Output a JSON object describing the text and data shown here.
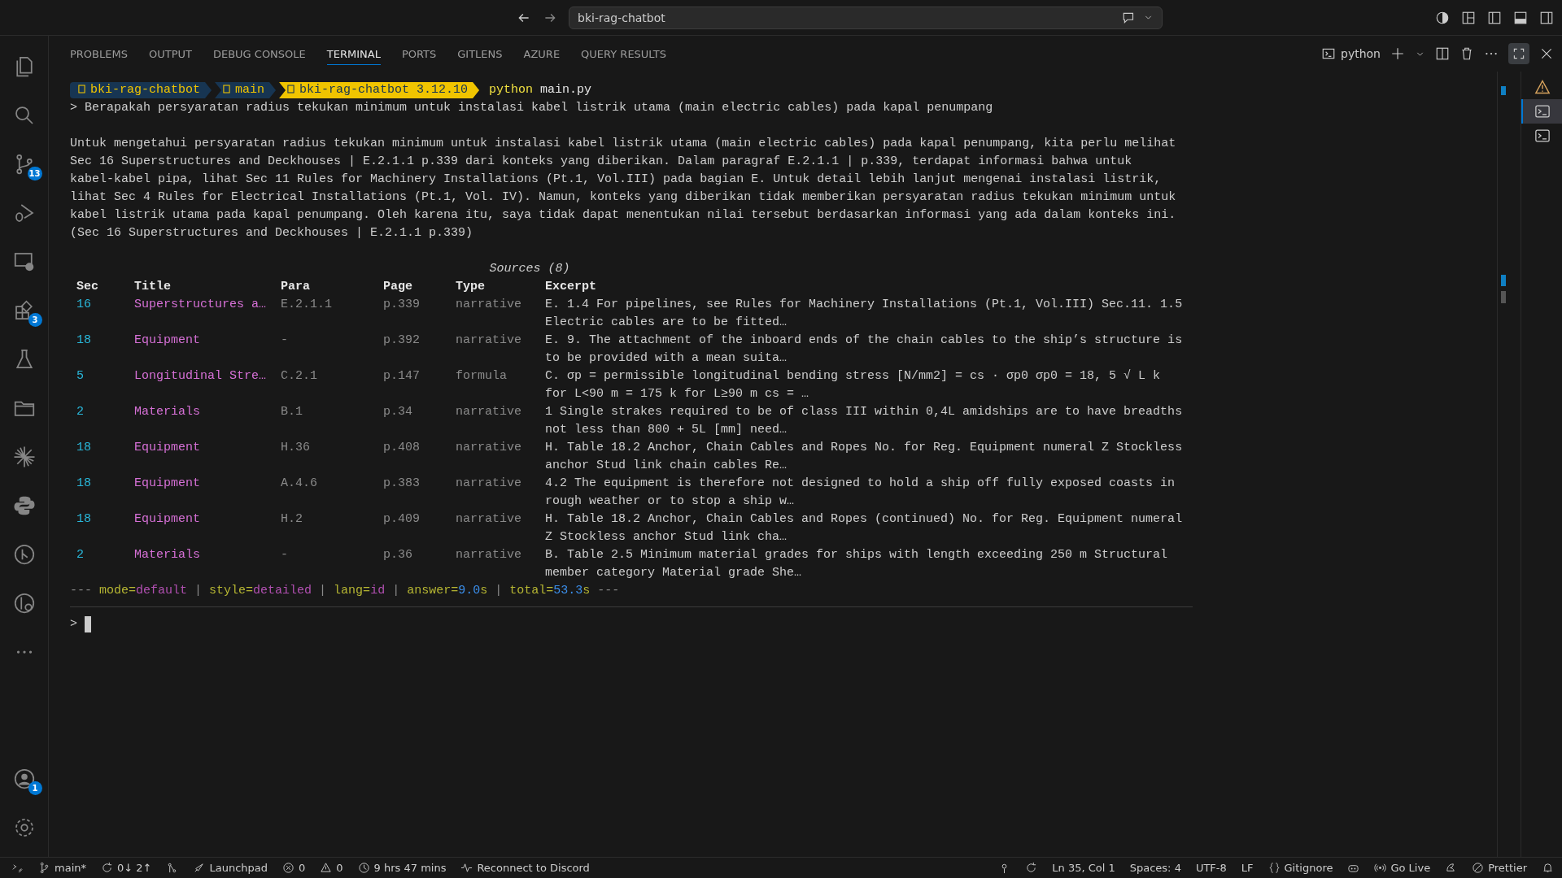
{
  "title_bar": {
    "search": "bki-rag-chatbot"
  },
  "activity_bar": [
    {
      "kind": "files",
      "selected": false
    },
    {
      "kind": "search",
      "selected": false
    },
    {
      "kind": "source-control",
      "selected": false,
      "badge": "13"
    },
    {
      "kind": "debug",
      "selected": false
    },
    {
      "kind": "remote",
      "selected": false
    },
    {
      "kind": "extensions",
      "selected": false,
      "badge": "3"
    },
    {
      "kind": "testing",
      "selected": false
    },
    {
      "kind": "folder",
      "selected": false
    },
    {
      "kind": "spark",
      "selected": false
    },
    {
      "kind": "python",
      "selected": false
    },
    {
      "kind": "git-graph",
      "selected": false
    },
    {
      "kind": "git-search",
      "selected": false
    },
    {
      "kind": "more",
      "selected": false
    }
  ],
  "activity_bottom": [
    {
      "kind": "account",
      "badge": "1"
    },
    {
      "kind": "settings"
    }
  ],
  "panel_tabs": [
    {
      "label": "PROBLEMS",
      "selected": false
    },
    {
      "label": "OUTPUT",
      "selected": false
    },
    {
      "label": "DEBUG CONSOLE",
      "selected": false
    },
    {
      "label": "TERMINAL",
      "selected": true
    },
    {
      "label": "PORTS",
      "selected": false
    },
    {
      "label": "GITLENS",
      "selected": false
    },
    {
      "label": "AZURE",
      "selected": false
    },
    {
      "label": "QUERY RESULTS",
      "selected": false
    }
  ],
  "terminal_toolbar": {
    "profile": "python"
  },
  "prompt": {
    "segments": [
      {
        "text": "bki-rag-chatbot",
        "kind": "folder"
      },
      {
        "text": "main",
        "kind": "branch"
      },
      {
        "text": "bki-rag-chatbot 3.12.10",
        "kind": "env"
      }
    ],
    "command": "python",
    "argument": "main.py"
  },
  "question": "> Berapakah persyaratan radius tekukan minimum untuk instalasi kabel listrik utama (main electric cables) pada kapal penumpang",
  "answer_lines": [
    "Untuk mengetahui persyaratan radius tekukan minimum untuk instalasi kabel listrik utama (main electric cables) pada kapal penumpang, kita perlu melihat",
    "Sec 16 Superstructures and Deckhouses | E.2.1.1 p.339 dari konteks yang diberikan. Dalam paragraf E.2.1.1 | p.339, terdapat informasi bahwa untuk",
    "kabel-kabel pipa, lihat Sec 11 Rules for Machinery Installations (Pt.1, Vol.III) pada bagian E. Untuk detail lebih lanjut mengenai instalasi listrik,",
    "lihat Sec 4 Rules for Electrical Installations (Pt.1, Vol. IV). Namun, konteks yang diberikan tidak memberikan persyaratan radius tekukan minimum untuk",
    "kabel listrik utama pada kapal penumpang. Oleh karena itu, saya tidak dapat menentukan nilai tersebut berdasarkan informasi yang ada dalam konteks ini.",
    "(Sec 16 Superstructures and Deckhouses | E.2.1.1 p.339)"
  ],
  "sources": {
    "title": "Sources (8)",
    "columns": [
      "Sec",
      "Title",
      "Para",
      "Page",
      "Type",
      "Excerpt"
    ],
    "rows": [
      {
        "sec": "16",
        "title": "Superstructures a…",
        "para": "E.2.1.1",
        "page": "p.339",
        "type": "narrative",
        "excerpt": [
          "E. 1.4 For pipelines, see Rules for Machinery Installations (Pt.1, Vol.III) Sec.11. 1.5",
          "Electric cables are to be fitted…"
        ]
      },
      {
        "sec": "18",
        "title": "Equipment",
        "para": "-",
        "page": "p.392",
        "type": "narrative",
        "excerpt": [
          "E. 9. The attachment of the inboard ends of the chain cables to the ship’s structure is",
          "to be provided with a mean suita…"
        ]
      },
      {
        "sec": "5",
        "title": "Longitudinal Stre…",
        "para": "C.2.1",
        "page": "p.147",
        "type": "formula",
        "excerpt": [
          "C. σp = permissible longitudinal bending stress [N/mm2] = cs · σp0 σp0 = 18, 5 √ L k",
          "for L<90 m = 175 k for L≥90 m cs = …"
        ]
      },
      {
        "sec": "2",
        "title": "Materials",
        "para": "B.1",
        "page": "p.34",
        "type": "narrative",
        "excerpt": [
          "1 Single strakes required to be of class III within 0,4L amidships are to have breadths",
          "not less than 800 + 5L [mm] need…"
        ]
      },
      {
        "sec": "18",
        "title": "Equipment",
        "para": "H.36",
        "page": "p.408",
        "type": "narrative",
        "excerpt": [
          "H. Table 18.2 Anchor, Chain Cables and Ropes No. for Reg. Equipment numeral Z Stockless",
          "anchor Stud link chain cables Re…"
        ]
      },
      {
        "sec": "18",
        "title": "Equipment",
        "para": "A.4.6",
        "page": "p.383",
        "type": "narrative",
        "excerpt": [
          "4.2 The equipment is therefore not designed to hold a ship off fully exposed coasts in",
          "rough weather or to stop a ship w…"
        ]
      },
      {
        "sec": "18",
        "title": "Equipment",
        "para": "H.2",
        "page": "p.409",
        "type": "narrative",
        "excerpt": [
          "H. Table 18.2 Anchor, Chain Cables and Ropes (continued) No. for Reg. Equipment numeral",
          "Z Stockless anchor Stud link cha…"
        ]
      },
      {
        "sec": "2",
        "title": "Materials",
        "para": "-",
        "page": "p.36",
        "type": "narrative",
        "excerpt": [
          "B. Table 2.5 Minimum material grades for ships with length exceeding 250 m Structural",
          "member category Material grade She…"
        ]
      }
    ]
  },
  "stats": {
    "fence": "---",
    "separator": "|",
    "items": [
      {
        "key": "mode=",
        "value": "default",
        "kind": "text"
      },
      {
        "key": "style=",
        "value": "detailed",
        "kind": "text"
      },
      {
        "key": "lang=",
        "value": "id",
        "kind": "text"
      },
      {
        "key": "answer=",
        "value": "9.0",
        "unit": "s",
        "kind": "number"
      },
      {
        "key": "total=",
        "value": "53.3",
        "unit": "s",
        "kind": "number"
      }
    ]
  },
  "input_prompt": ">",
  "terminal_list": [
    {
      "kind": "warning",
      "selected": false
    },
    {
      "kind": "terminal",
      "selected": true
    },
    {
      "kind": "terminal",
      "selected": false
    }
  ],
  "status_left": [
    {
      "kind": "remote"
    },
    {
      "kind": "branch",
      "text": "main*"
    },
    {
      "kind": "sync",
      "text": "0↓ 2↑"
    },
    {
      "kind": "graph"
    },
    {
      "kind": "launchpad",
      "text": "Launchpad"
    },
    {
      "kind": "errors",
      "text": "0"
    },
    {
      "kind": "warnings",
      "text": "0"
    },
    {
      "kind": "clock",
      "text": "9 hrs 47 mins"
    },
    {
      "kind": "pulse",
      "text": "Reconnect to Discord"
    }
  ],
  "status_right": [
    {
      "kind": "pin"
    },
    {
      "kind": "refresh"
    },
    {
      "kind": "plain",
      "text": "Ln 35, Col 1"
    },
    {
      "kind": "plain",
      "text": "Spaces: 4"
    },
    {
      "kind": "plain",
      "text": "UTF-8"
    },
    {
      "kind": "plain",
      "text": "LF"
    },
    {
      "kind": "braces",
      "text": "Gitignore"
    },
    {
      "kind": "copilot"
    },
    {
      "kind": "broadcast",
      "text": "Go Live"
    },
    {
      "kind": "spell"
    },
    {
      "kind": "prettier",
      "text": "Prettier"
    },
    {
      "kind": "bell"
    }
  ]
}
